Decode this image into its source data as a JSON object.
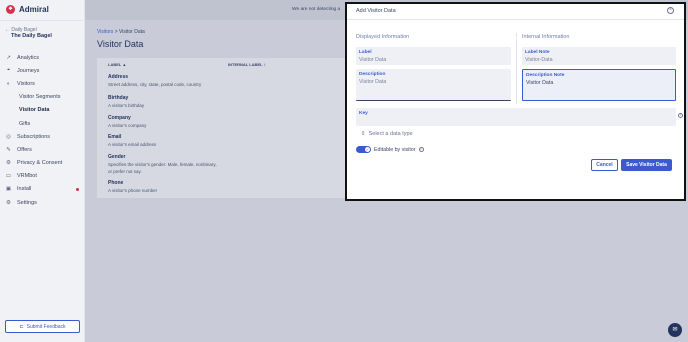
{
  "brand": {
    "logo_icon": "admiral-logo",
    "name": "Admiral"
  },
  "account": {
    "sub": "Daily Bagel",
    "name": "The Daily Bagel"
  },
  "nav": [
    {
      "label": "Analytics",
      "icon": "chart-line-icon",
      "glyph": "↗"
    },
    {
      "label": "Journeys",
      "icon": "journeys-icon",
      "glyph": "⌖"
    },
    {
      "label": "Visitors",
      "icon": "visitors-icon",
      "glyph": "◐"
    },
    {
      "label": "Visitor Segments",
      "sub": true
    },
    {
      "label": "Visitor Data",
      "sub": true,
      "active": true
    },
    {
      "label": "Gifts",
      "sub": true
    },
    {
      "label": "Subscriptions",
      "icon": "subscriptions-icon",
      "glyph": "◎"
    },
    {
      "label": "Offers",
      "icon": "offers-icon",
      "glyph": "✎"
    },
    {
      "label": "Privacy & Consent",
      "icon": "privacy-icon",
      "glyph": "⚙"
    },
    {
      "label": "VRMbot",
      "icon": "chat-icon",
      "glyph": "▭"
    },
    {
      "label": "Install",
      "icon": "install-icon",
      "glyph": "▣",
      "badge": true
    },
    {
      "label": "Settings",
      "icon": "settings-icon",
      "glyph": "⚙"
    }
  ],
  "feedback_label": "Submit Feedback",
  "topbar_msg": "We are not detecting a",
  "breadcrumb": {
    "parent": "Visitors",
    "sep": " > ",
    "current": "Visitor Data"
  },
  "page_title": "Visitor Data",
  "table": {
    "headers": [
      "LABEL ▲",
      "INTERNAL LABEL ↕"
    ],
    "rows": [
      {
        "name": "Address",
        "desc": "Street address, city, state, postal code, country"
      },
      {
        "name": "Birthday",
        "desc": "A visitor's birthday"
      },
      {
        "name": "Company",
        "desc": "A visitor's company"
      },
      {
        "name": "Email",
        "desc": "A visitor's email address"
      },
      {
        "name": "Gender",
        "desc": "Specifies the visitor's gender: Male, female, nonbinary, or prefer not say."
      },
      {
        "name": "Phone",
        "desc": "A visitor's phone number"
      }
    ]
  },
  "dialog": {
    "title": "Add Visitor Data",
    "displayed_heading": "Displayed Information",
    "internal_heading": "Internal Information",
    "label": {
      "label": "Label",
      "placeholder": "Visitor Data"
    },
    "label_note": {
      "label": "Label Note",
      "placeholder": "Visitor-Data"
    },
    "description": {
      "label": "Description",
      "value": "Visitor Data"
    },
    "description_note": {
      "label": "Description Note",
      "value": "Visitor Data"
    },
    "key": {
      "label": "Key"
    },
    "select_placeholder": "Select a data type",
    "editable_label": "Editable by visitor",
    "editable_on": true,
    "cancel_label": "Cancel",
    "save_label": "Save Visitor Data"
  },
  "colors": {
    "accent": "#3a5bd0",
    "brand": "#d6304e",
    "navy": "#24335f"
  }
}
